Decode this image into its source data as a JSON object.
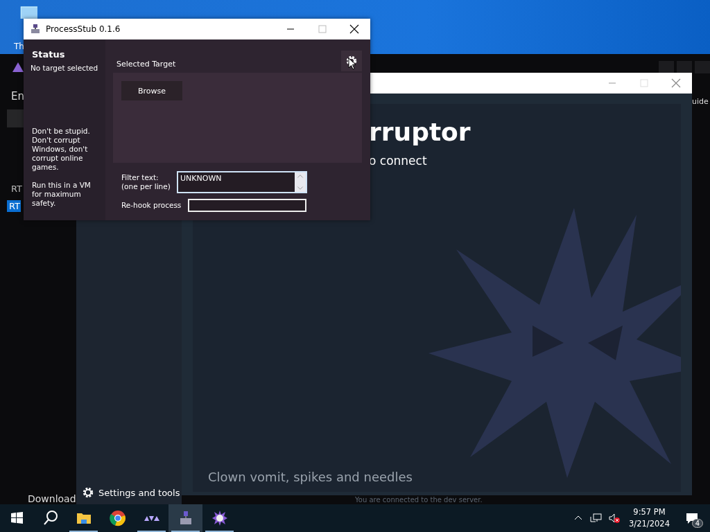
{
  "desktop": {
    "icon_label": "Th"
  },
  "rtc_window": {
    "label_1": "En",
    "label_2": "RT",
    "selected_item": "RT",
    "guide_fragment": "uide",
    "download_fragment": "Download",
    "settings_link": "Settings and tools",
    "tagline": "Clown vomit, spikes and needles",
    "status": "You are connected to the dev server."
  },
  "corruptor_window": {
    "title_fragment": "rruptor",
    "subtitle_fragment": "o connect"
  },
  "processstub": {
    "title": "ProcessStub 0.1.6",
    "status_heading": "Status",
    "status": "No target selected",
    "warning": "Don't be stupid. Don't corrupt Windows, don't corrupt online games.",
    "vm_note": "Run this in a VM for maximum safety.",
    "section_title": "Selected Target",
    "browse": "Browse",
    "filter_label": "Filter text:\n(one per line)",
    "filter_value": "UNKNOWN",
    "rehook_label": "Re-hook process"
  },
  "taskbar": {
    "apps": [
      {
        "kind": "folder",
        "running": true,
        "selected": false
      },
      {
        "kind": "browser",
        "running": false,
        "selected": false
      },
      {
        "kind": "triangles",
        "running": true,
        "selected": false
      },
      {
        "kind": "stub",
        "running": true,
        "selected": true
      },
      {
        "kind": "spiky",
        "running": true,
        "selected": false
      }
    ],
    "time": "9:57 PM",
    "date": "3/21/2024",
    "notifications": "4"
  }
}
